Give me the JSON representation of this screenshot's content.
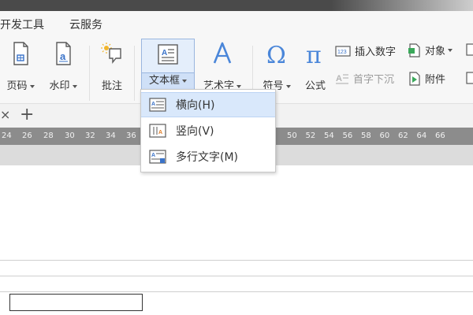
{
  "menubar": {
    "items": [
      {
        "label": "开发工具"
      },
      {
        "label": "云服务"
      }
    ]
  },
  "ribbon": {
    "page_number": {
      "label": "页码"
    },
    "watermark": {
      "label": "水印"
    },
    "comment": {
      "label": "批注"
    },
    "textbox": {
      "label": "文本框"
    },
    "wordart": {
      "label": "艺术字"
    },
    "symbol": {
      "label": "符号"
    },
    "formula": {
      "label": "公式"
    },
    "insert_number": {
      "label": "插入数字"
    },
    "object": {
      "label": "对象"
    },
    "drop_cap": {
      "label": "首字下沉"
    },
    "attachment": {
      "label": "附件"
    }
  },
  "tabbar": {
    "close_glyph": "×",
    "add_glyph": "+"
  },
  "ruler": {
    "numbers": [
      "24",
      "26",
      "28",
      "30",
      "32",
      "34",
      "36",
      "50",
      "52",
      "54",
      "56",
      "58",
      "60",
      "62",
      "64",
      "66"
    ]
  },
  "dropdown": {
    "items": [
      {
        "label": "横向(H)"
      },
      {
        "label": "竖向(V)"
      },
      {
        "label": "多行文字(M)"
      }
    ]
  },
  "colors": {
    "accent": "#3a73c9",
    "selection": "#d9e8fb"
  }
}
